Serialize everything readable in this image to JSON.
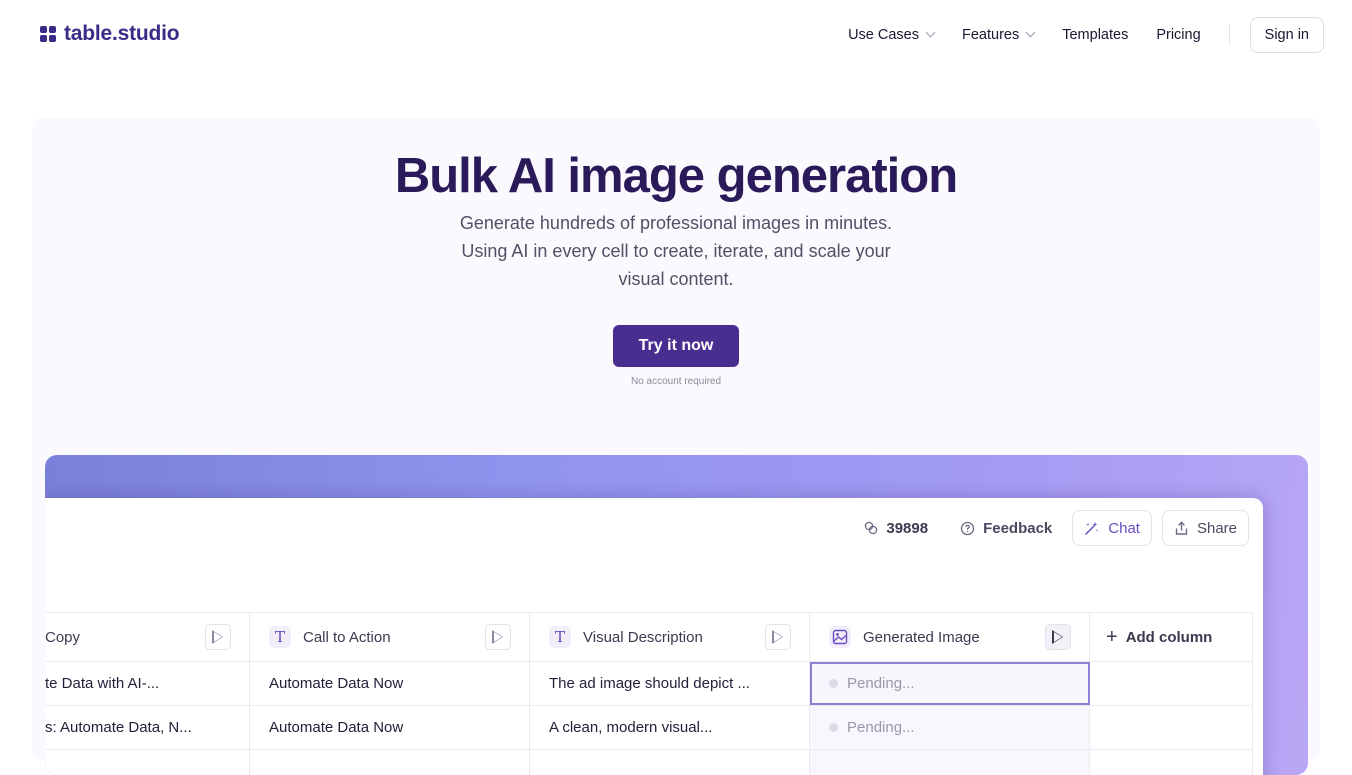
{
  "brand": {
    "name": "table.studio",
    "accent": "#3b2a86"
  },
  "nav": {
    "items": [
      {
        "label": "Use Cases",
        "dropdown": true
      },
      {
        "label": "Features",
        "dropdown": true
      },
      {
        "label": "Templates",
        "dropdown": false
      },
      {
        "label": "Pricing",
        "dropdown": false
      }
    ],
    "signin": "Sign in"
  },
  "hero": {
    "title": "Bulk AI image generation",
    "subtitle": "Generate hundreds of professional images in minutes. Using AI in every cell to create, iterate, and scale your visual content.",
    "cta": "Try it now",
    "cta_note": "No account required",
    "cta_color": "#4a2e8f"
  },
  "app": {
    "toolbar": {
      "credits": "39898",
      "feedback": "Feedback",
      "chat": "Chat",
      "share": "Share"
    },
    "columns": [
      {
        "label": "Copy",
        "type_icon": ""
      },
      {
        "label": "Call to Action",
        "type_icon": "T"
      },
      {
        "label": "Visual Description",
        "type_icon": "T"
      },
      {
        "label": "Generated Image",
        "type_icon": "image-icon"
      }
    ],
    "add_column": "Add column",
    "rows": [
      {
        "copy": "te Data with AI-...",
        "cta": "Automate Data Now",
        "visual": "The ad image should depict ...",
        "image": "Pending..."
      },
      {
        "copy": "s: Automate Data, N...",
        "cta": "Automate Data Now",
        "visual": "A clean, modern visual...",
        "image": "Pending..."
      }
    ]
  }
}
